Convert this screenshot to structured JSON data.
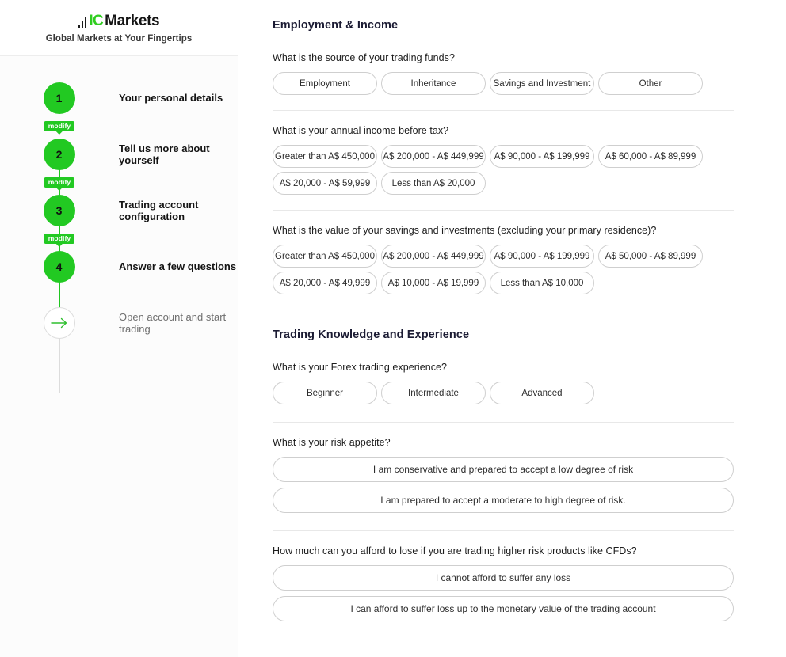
{
  "brand": {
    "logo_mark": "bar-chart-icon",
    "logo_ic": "IC",
    "logo_markets": "Markets",
    "tagline": "Global Markets at Your Fingertips"
  },
  "sidebar": {
    "steps": [
      {
        "number": "1",
        "label": "Your personal details",
        "action": "modify"
      },
      {
        "number": "2",
        "label": "Tell us more about yourself",
        "action": "modify"
      },
      {
        "number": "3",
        "label": "Trading account configuration",
        "action": "modify"
      },
      {
        "number": "4",
        "label": "Answer a few questions",
        "action": ""
      }
    ],
    "final_step": {
      "label": "Open account and start trading",
      "icon": "arrow-right-icon"
    }
  },
  "colors": {
    "brand_green": "#22c922",
    "logo_green": "#2fcd1f",
    "pill_border": "#cfcfcf",
    "heading": "#1b1b33",
    "divider": "#e8e8e8"
  },
  "main": {
    "sections": [
      {
        "title": "Employment & Income",
        "questions": [
          {
            "label": "What is the source of your trading funds?",
            "layout": "grid4",
            "options": [
              "Employment",
              "Inheritance",
              "Savings and Investment",
              "Other"
            ]
          },
          {
            "label": "What is your annual income before tax?",
            "layout": "grid4",
            "options": [
              "Greater than A$ 450,000",
              "A$ 200,000 - A$ 449,999",
              "A$ 90,000 - A$ 199,999",
              "A$ 60,000 - A$ 89,999",
              "A$ 20,000 - A$ 59,999",
              "Less than A$ 20,000"
            ]
          },
          {
            "label": "What is the value of your savings and investments (excluding your primary residence)?",
            "layout": "grid4",
            "options": [
              "Greater than A$ 450,000",
              "A$ 200,000 - A$ 449,999",
              "A$ 90,000 - A$ 199,999",
              "A$ 50,000 - A$ 89,999",
              "A$ 20,000 - A$ 49,999",
              "A$ 10,000 - A$ 19,999",
              "Less than A$ 10,000"
            ]
          }
        ]
      },
      {
        "title": "Trading Knowledge and Experience",
        "questions": [
          {
            "label": "What is your Forex trading experience?",
            "layout": "grid3",
            "options": [
              "Beginner",
              "Intermediate",
              "Advanced"
            ]
          },
          {
            "label": "What is your risk appetite?",
            "layout": "wide",
            "options": [
              "I am conservative and prepared to accept a low degree of risk",
              "I am prepared to accept a moderate to high degree of risk."
            ]
          },
          {
            "label": "How much can you afford to lose if you are trading higher risk products like CFDs?",
            "layout": "wide",
            "options": [
              "I cannot afford to suffer any loss",
              "I can afford to suffer loss up to the monetary value of the trading account"
            ]
          }
        ]
      }
    ]
  }
}
